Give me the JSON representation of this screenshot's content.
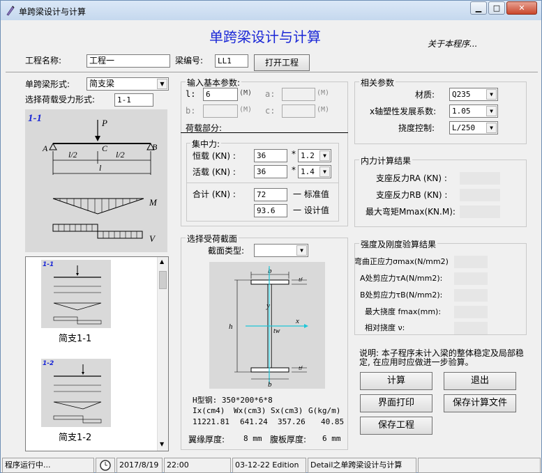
{
  "window": {
    "title": "单跨梁设计与计算"
  },
  "header": {
    "main_title": "单跨梁设计与计算",
    "about_link": "关于本程序..."
  },
  "project": {
    "name_label": "工程名称:",
    "name_value": "工程一",
    "beam_no_label": "梁编号:",
    "beam_no_value": "LL1",
    "open_button": "打开工程"
  },
  "beam_form": {
    "form_label": "单跨梁形式:",
    "form_value": "简支梁",
    "load_form_label": "选择荷载受力形式:",
    "load_form_value": "1-1"
  },
  "diagram": {
    "case_label": "1-1",
    "P": "P",
    "A": "A",
    "B": "B",
    "C": "C",
    "half_l": "l/2",
    "l": "l",
    "M": "M",
    "V": "V"
  },
  "thumbnails": [
    {
      "case": "1-1",
      "caption": "简支1-1"
    },
    {
      "case": "1-2",
      "caption": "简支1-2"
    }
  ],
  "input_basic": {
    "title": "输入基本参数:",
    "l_label": "l:",
    "l_value": "6",
    "l_unit": "(M)",
    "a_label": "a:",
    "a_value": "",
    "a_unit": "(M)",
    "b_label": "b:",
    "b_value": "",
    "b_unit": "(M)",
    "c_label": "c:",
    "c_value": "",
    "c_unit": "(M)",
    "load_section": "荷载部分:",
    "concentrated_title": "集中力:",
    "dead_label": "恒载 (KN) :",
    "dead_value": "36",
    "dead_factor": "1.2",
    "live_label": "活载 (KN) :",
    "live_value": "36",
    "live_factor": "1.4",
    "sum_label": "合计 (KN) :",
    "sum_std": "72",
    "sum_std_label": "一 标准值",
    "sum_design": "93.6",
    "sum_design_label": "一 设计值",
    "star": "*"
  },
  "section": {
    "title": "选择受荷截面",
    "type_label": "截面类型:",
    "type_value": "",
    "b": "b",
    "y": "y",
    "x": "x",
    "h": "h",
    "tw": "tw",
    "tf": "tf",
    "steel_desc": "H型钢: 350*200*6*8",
    "headers": [
      "Ix(cm4)",
      "Wx(cm3)",
      "Sx(cm3)",
      "G(kg/m)"
    ],
    "values": [
      "11221.81",
      "641.24",
      "357.26",
      "40.85"
    ],
    "flange_label": "翼缘厚度:",
    "flange_value": "8 mm",
    "web_label": "腹板厚度:",
    "web_value": "6 mm"
  },
  "related": {
    "title": "相关参数",
    "material_label": "材质:",
    "material_value": "Q235",
    "plastic_label": "x轴塑性发展系数:",
    "plastic_value": "1.05",
    "deflection_label": "挠度控制:",
    "deflection_value": "L/250"
  },
  "internal_force": {
    "title": "内力计算结果",
    "ra_label": "支座反力RA (KN) :",
    "rb_label": "支座反力RB (KN) :",
    "mmax_label": "最大弯矩Mmax(KN.M):"
  },
  "strength": {
    "title": "强度及刚度验算结果",
    "sigma_label": "弯曲正应力σmax(N/mm2)",
    "tau_a_label": "A处剪应力τA(N/mm2):",
    "tau_b_label": "B处剪应力τB(N/mm2):",
    "fmax_label": "最大挠度  fmax(mm):",
    "rel_label": "相对挠度      ν:"
  },
  "note": "说明: 本子程序未计入梁的整体稳定及局部稳定, 在应用时应做进一步验算。",
  "buttons": {
    "calc": "计算",
    "exit": "退出",
    "print": "界面打印",
    "save_file": "保存计算文件",
    "save_project": "保存工程"
  },
  "statusbar": {
    "running": "程序运行中...",
    "date": "2017/8/19",
    "time": "22:00",
    "edition": "03-12-22 Edition",
    "detail": "Detail之单跨梁设计与计算"
  }
}
